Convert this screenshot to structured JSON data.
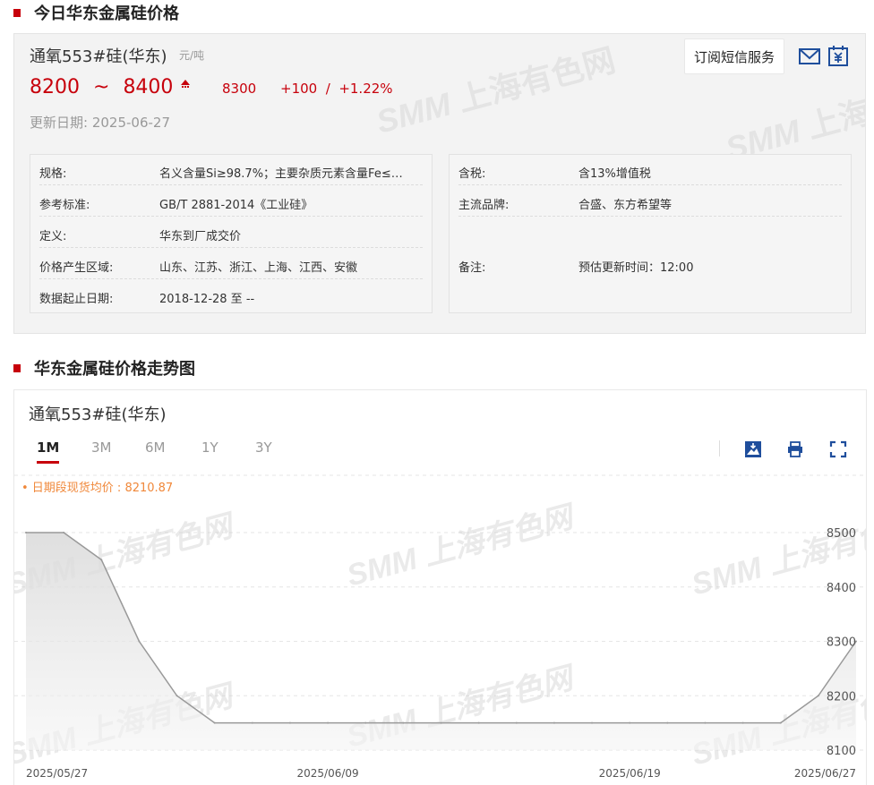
{
  "section1": {
    "title": "今日华东金属硅价格"
  },
  "product": {
    "name": "通氧553#硅(华东)",
    "unit": "元/吨",
    "price_low": "8200",
    "tilde": "~",
    "price_high": "8400",
    "prev_price": "8300",
    "change": "+100  /  +1.22%",
    "update_date": "更新日期: 2025-06-27"
  },
  "actions": {
    "subscribe": "订阅短信服务",
    "mail_icon": "mail-icon",
    "calendar_icon": "yuan-calendar-icon"
  },
  "info_left": [
    {
      "key": "规格:",
      "value": "名义含量Si≥98.7%；主要杂质元素含量Fe≤…"
    },
    {
      "key": "参考标准:",
      "value": "GB/T 2881-2014《工业硅》"
    },
    {
      "key": "定义:",
      "value": "华东到厂成交价"
    },
    {
      "key": "价格产生区域:",
      "value": "山东、江苏、浙江、上海、江西、安徽"
    },
    {
      "key": "数据起止日期:",
      "value": "2018-12-28 至 --"
    }
  ],
  "info_right": [
    {
      "key": "含税:",
      "value": "含13%增值税"
    },
    {
      "key": "主流品牌:",
      "value": "合盛、东方希望等"
    },
    {
      "key": "备注:",
      "value": "预估更新时间：12:00"
    }
  ],
  "section2": {
    "title": "华东金属硅价格走势图"
  },
  "chart_panel": {
    "name": "通氧553#硅(华东)",
    "tabs": [
      "1M",
      "3M",
      "6M",
      "1Y",
      "3Y"
    ],
    "active_tab": "1M",
    "avg_label": "• 日期段现货均价 : 8210.87",
    "tool_icons": [
      "download-image-icon",
      "print-icon",
      "fullscreen-icon"
    ]
  },
  "watermark": {
    "latin": "SMM",
    "cn": "上海有色网"
  },
  "colors": {
    "red": "#c7000b",
    "orange": "#f0883a",
    "blue": "#1f4e9c",
    "line": "#999999"
  },
  "chart_data": {
    "type": "area",
    "x": [
      "2025/05/27",
      "2025/05/28",
      "2025/05/29",
      "2025/05/30",
      "2025/06/03",
      "2025/06/04",
      "2025/06/05",
      "2025/06/06",
      "2025/06/09",
      "2025/06/10",
      "2025/06/11",
      "2025/06/12",
      "2025/06/13",
      "2025/06/16",
      "2025/06/17",
      "2025/06/18",
      "2025/06/19",
      "2025/06/20",
      "2025/06/23",
      "2025/06/24",
      "2025/06/25",
      "2025/06/26",
      "2025/06/27"
    ],
    "series": [
      {
        "values": [
          8500,
          8500,
          8450,
          8300,
          8200,
          8150,
          8150,
          8150,
          8150,
          8150,
          8150,
          8150,
          8150,
          8150,
          8150,
          8150,
          8150,
          8150,
          8150,
          8150,
          8150,
          8200,
          8300
        ]
      }
    ],
    "x_tick_labels": [
      "2025/05/27",
      "2025/06/09",
      "2025/06/19",
      "2025/06/27"
    ],
    "y_ticks": [
      8100,
      8200,
      8300,
      8400,
      8500
    ],
    "ylim": [
      8100,
      8500
    ],
    "grid": true
  }
}
